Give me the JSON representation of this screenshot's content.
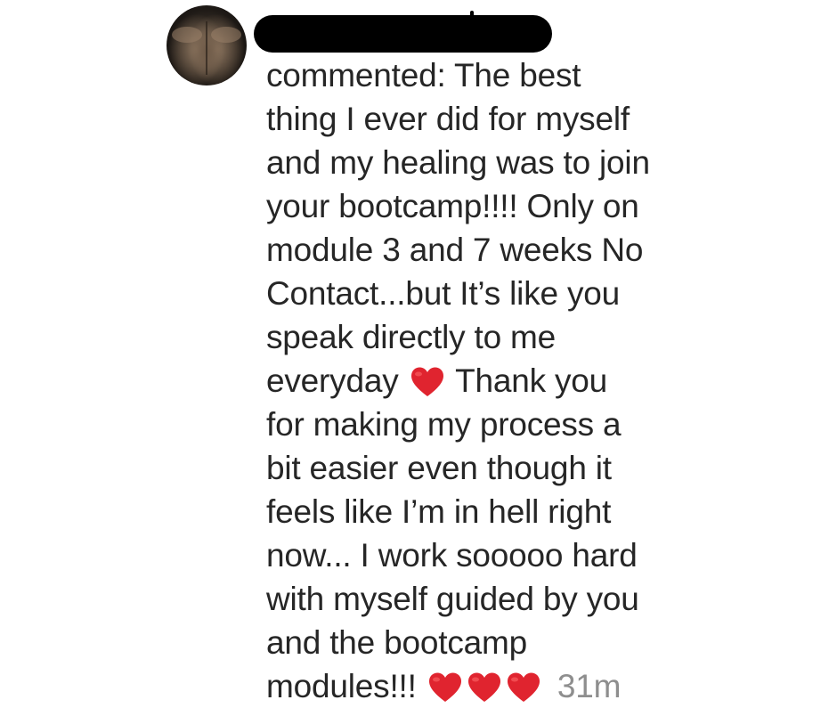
{
  "comment": {
    "username": "",
    "lines": [
      "commented: The best",
      "thing I ever did for myself",
      "and my healing was to join",
      "your bootcamp!!!! Only on",
      "module 3 and 7 weeks No",
      "Contact...but It’s like you",
      "speak directly to me"
    ],
    "line8_before": "everyday",
    "line8_after": "Thank you",
    "lines_after": [
      "for making my process a",
      "bit easier even though it",
      "feels like I’m in hell right",
      "now... I work sooooo hard",
      "with myself guided by you",
      "and the bootcamp"
    ],
    "last_line_text": "modules!!!",
    "timestamp": "31m"
  },
  "icons": {
    "avatar": "profile-photo",
    "heart": "red-heart-emoji"
  },
  "colors": {
    "text": "#262626",
    "timestamp": "#8e8e8e",
    "heart": "#e0242f",
    "redaction": "#000000"
  }
}
